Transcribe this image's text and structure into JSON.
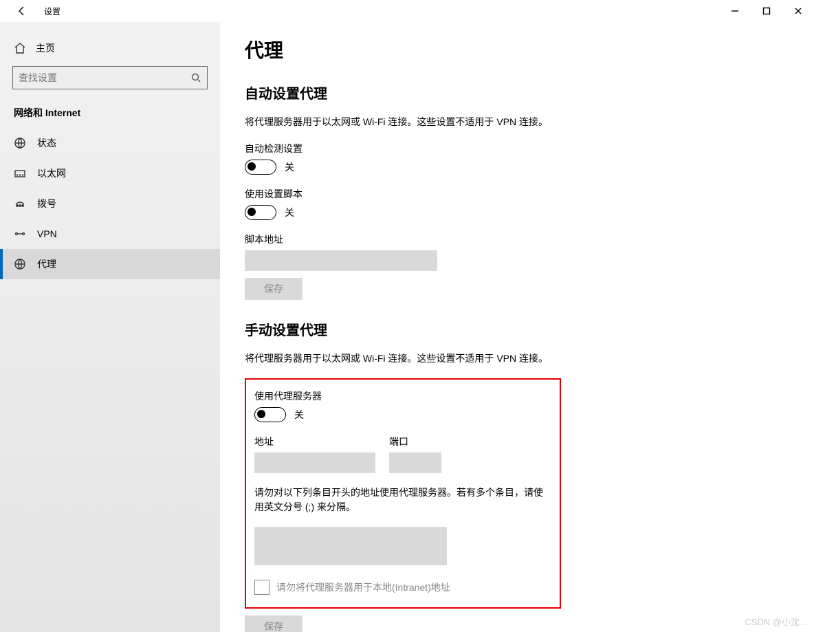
{
  "app_title": "设置",
  "home_label": "主页",
  "search_placeholder": "查找设置",
  "group_title": "网络和 Internet",
  "nav": {
    "status": "状态",
    "ethernet": "以太网",
    "dialup": "拨号",
    "vpn": "VPN",
    "proxy": "代理"
  },
  "page": {
    "title": "代理",
    "auto": {
      "heading": "自动设置代理",
      "desc": "将代理服务器用于以太网或 Wi-Fi 连接。这些设置不适用于 VPN 连接。",
      "detect_label": "自动检测设置",
      "detect_state": "关",
      "script_label": "使用设置脚本",
      "script_state": "关",
      "script_addr_label": "脚本地址",
      "script_addr_value": "",
      "save": "保存"
    },
    "manual": {
      "heading": "手动设置代理",
      "desc": "将代理服务器用于以太网或 Wi-Fi 连接。这些设置不适用于 VPN 连接。",
      "use_label": "使用代理服务器",
      "use_state": "关",
      "addr_label": "地址",
      "addr_value": "",
      "port_label": "端口",
      "port_value": "",
      "except_label": "请勿对以下列条目开头的地址使用代理服务器。若有多个条目，请使用英文分号 (;) 来分隔。",
      "except_value": "",
      "local_label": "请勿将代理服务器用于本地(Intranet)地址",
      "save": "保存"
    }
  },
  "watermark": "CSDN @小沈…"
}
